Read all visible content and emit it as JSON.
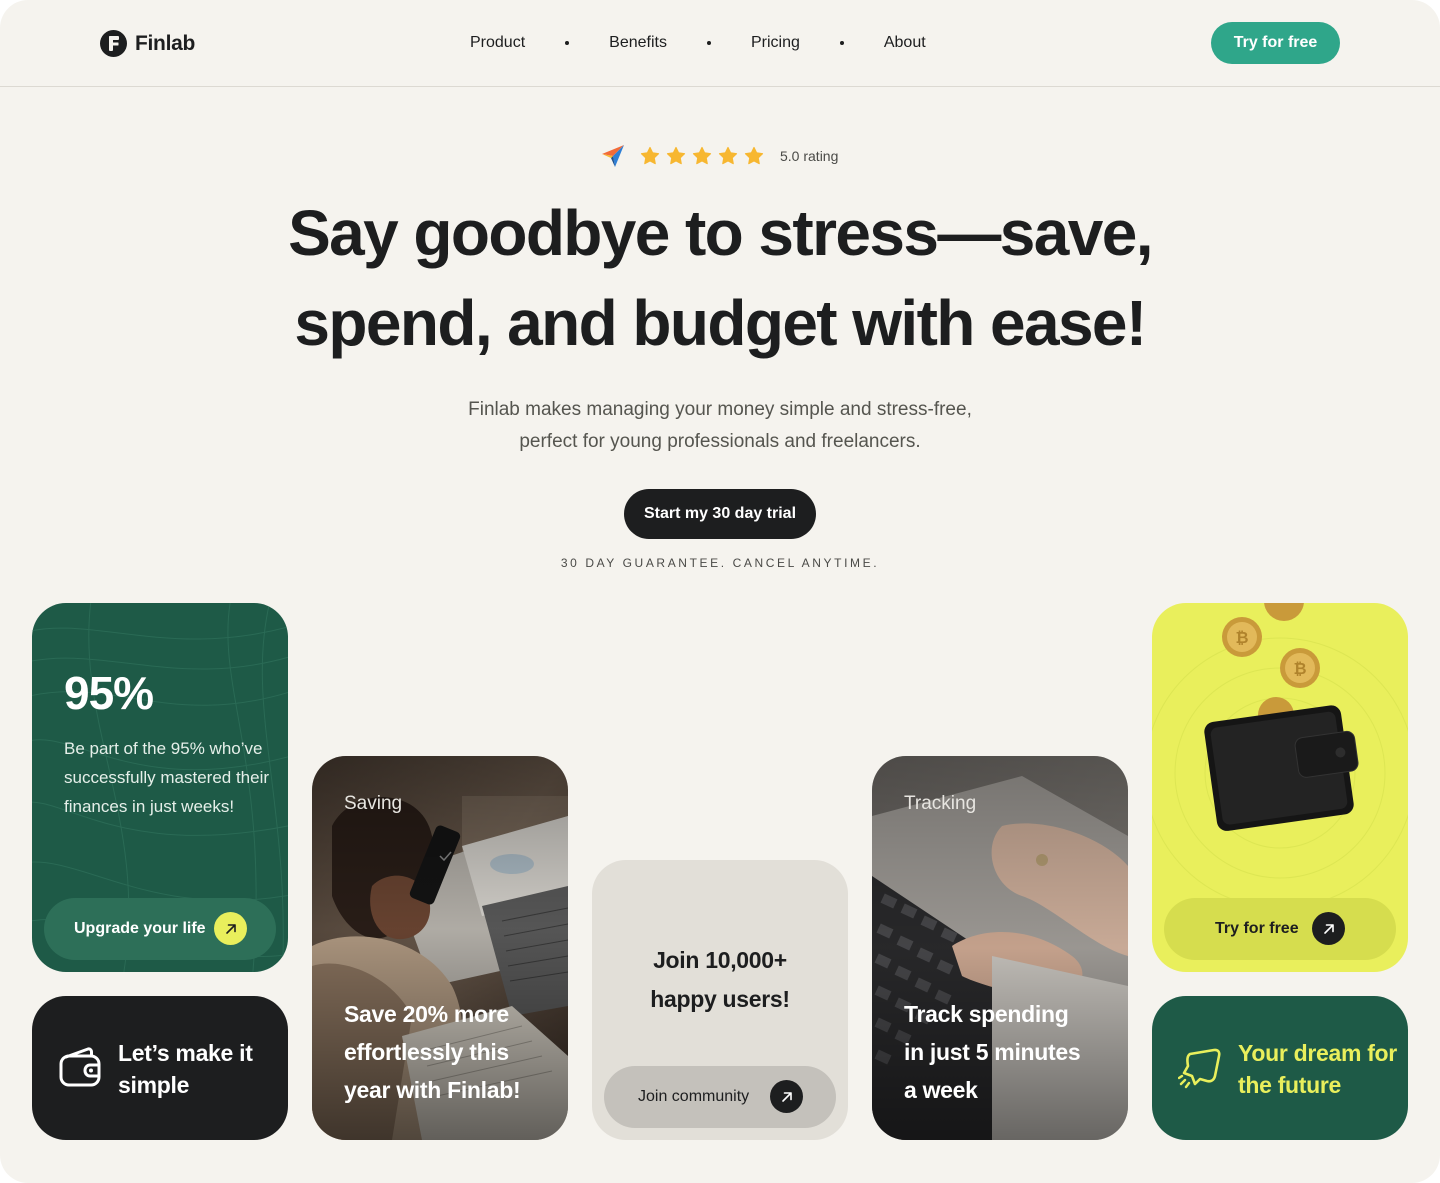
{
  "brand": {
    "name": "Finlab"
  },
  "nav": {
    "links": [
      "Product",
      "Benefits",
      "Pricing",
      "About"
    ],
    "cta": "Try for free"
  },
  "hero": {
    "rating_stars": 5,
    "rating_text": "5.0 rating",
    "headline_line1": "Say goodbye to stress—save,",
    "headline_line2": "spend, and budget with ease!",
    "subhead_line1": "Finlab makes managing your money simple and stress-free,",
    "subhead_line2": "perfect for young professionals and freelancers.",
    "cta": "Start my 30 day trial",
    "guarantee": "30 DAY GUARANTEE. CANCEL ANYTIME."
  },
  "cards": {
    "stat": {
      "value": "95%",
      "desc": "Be part of the 95% who’ve successfully mastered their finances in just weeks!",
      "cta": "Upgrade your life"
    },
    "simple": {
      "text": "Let’s make it simple"
    },
    "saving": {
      "label": "Saving",
      "title": "Save 20% more effortlessly this year with Finlab!"
    },
    "community": {
      "title": "Join 10,000+ happy users!",
      "cta": "Join community"
    },
    "tracking": {
      "label": "Tracking",
      "title": "Track spending in just 5 minutes a week"
    },
    "wallet": {
      "cta": "Try for free"
    },
    "future": {
      "text": "Your dream for the future"
    }
  },
  "colors": {
    "background": "#f5f3ee",
    "accent_teal": "#2fa68a",
    "deep_green": "#1e5a47",
    "lime": "#e9ef5c",
    "dark": "#1d1e1f",
    "star": "#f7b731"
  }
}
